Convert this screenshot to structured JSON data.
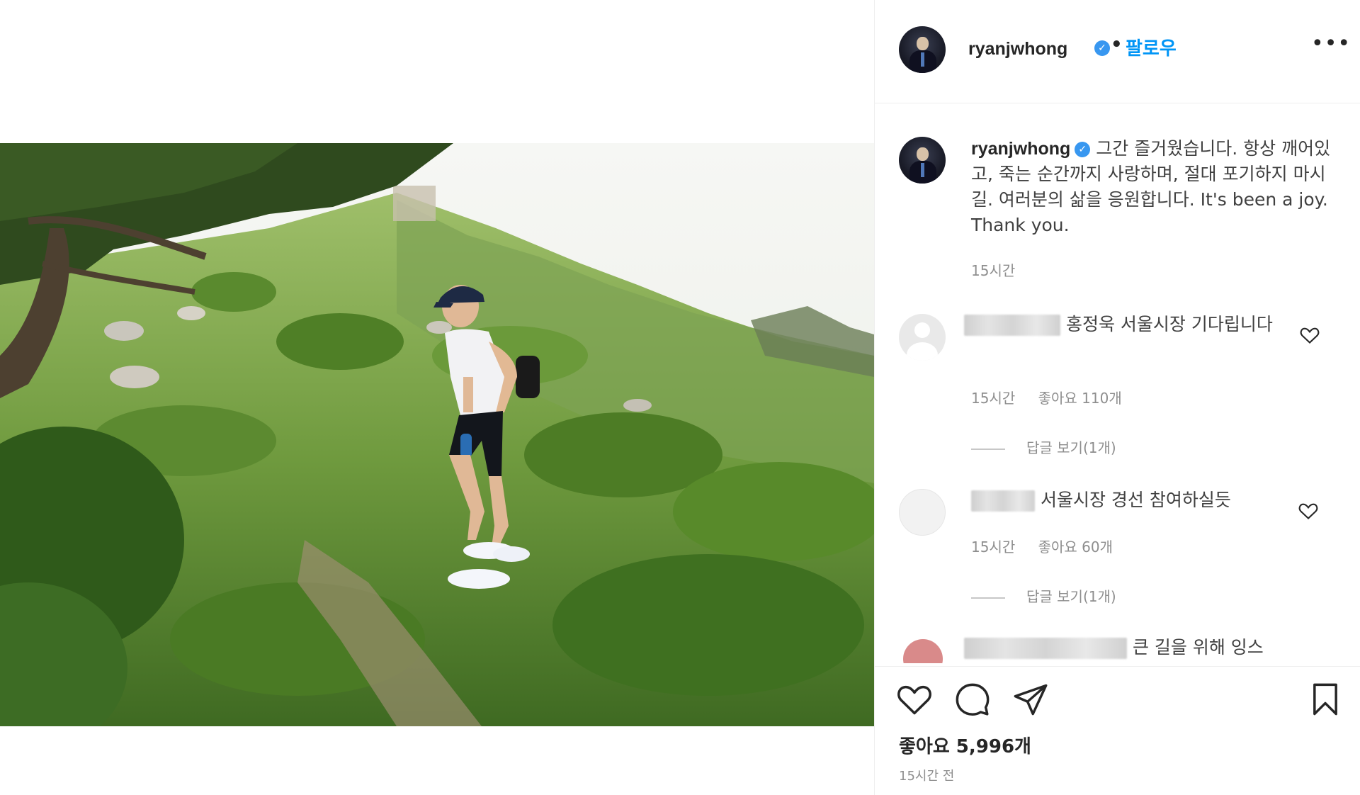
{
  "post": {
    "username": "ryanjwhong",
    "verified_icon": "verified-badge-icon",
    "follow_label": "팔로우",
    "separator": "•",
    "more_label": "•••"
  },
  "caption": {
    "username": "ryanjwhong",
    "text": "그간 즐거웠습니다. 항상 깨어있고, 죽는 순간까지 사랑하며, 절대 포기하지 마시길. 여러분의 삶을 응원합니다. It's been a joy. Thank you.",
    "time": "15시간"
  },
  "comments": [
    {
      "text": "홍정욱 서울시장 기다립니다",
      "time": "15시간",
      "likes": "좋아요 110개",
      "replies": "답글 보기(1개)"
    },
    {
      "text": "서울시장 경선 참여하실듯",
      "time": "15시간",
      "likes": "좋아요 60개",
      "replies": "답글 보기(1개)"
    }
  ],
  "partial_comment": {
    "text": "큰 길을 위해 잉스"
  },
  "actions": {
    "like_icon": "heart-icon",
    "comment_icon": "comment-icon",
    "share_icon": "share-icon",
    "save_icon": "bookmark-icon",
    "likes_label": "좋아요 5,996개",
    "time_ago": "15시간 전"
  },
  "colors": {
    "link": "#0095f6",
    "verified": "#3897f0",
    "muted": "#8e8e8e",
    "text": "#262626"
  }
}
